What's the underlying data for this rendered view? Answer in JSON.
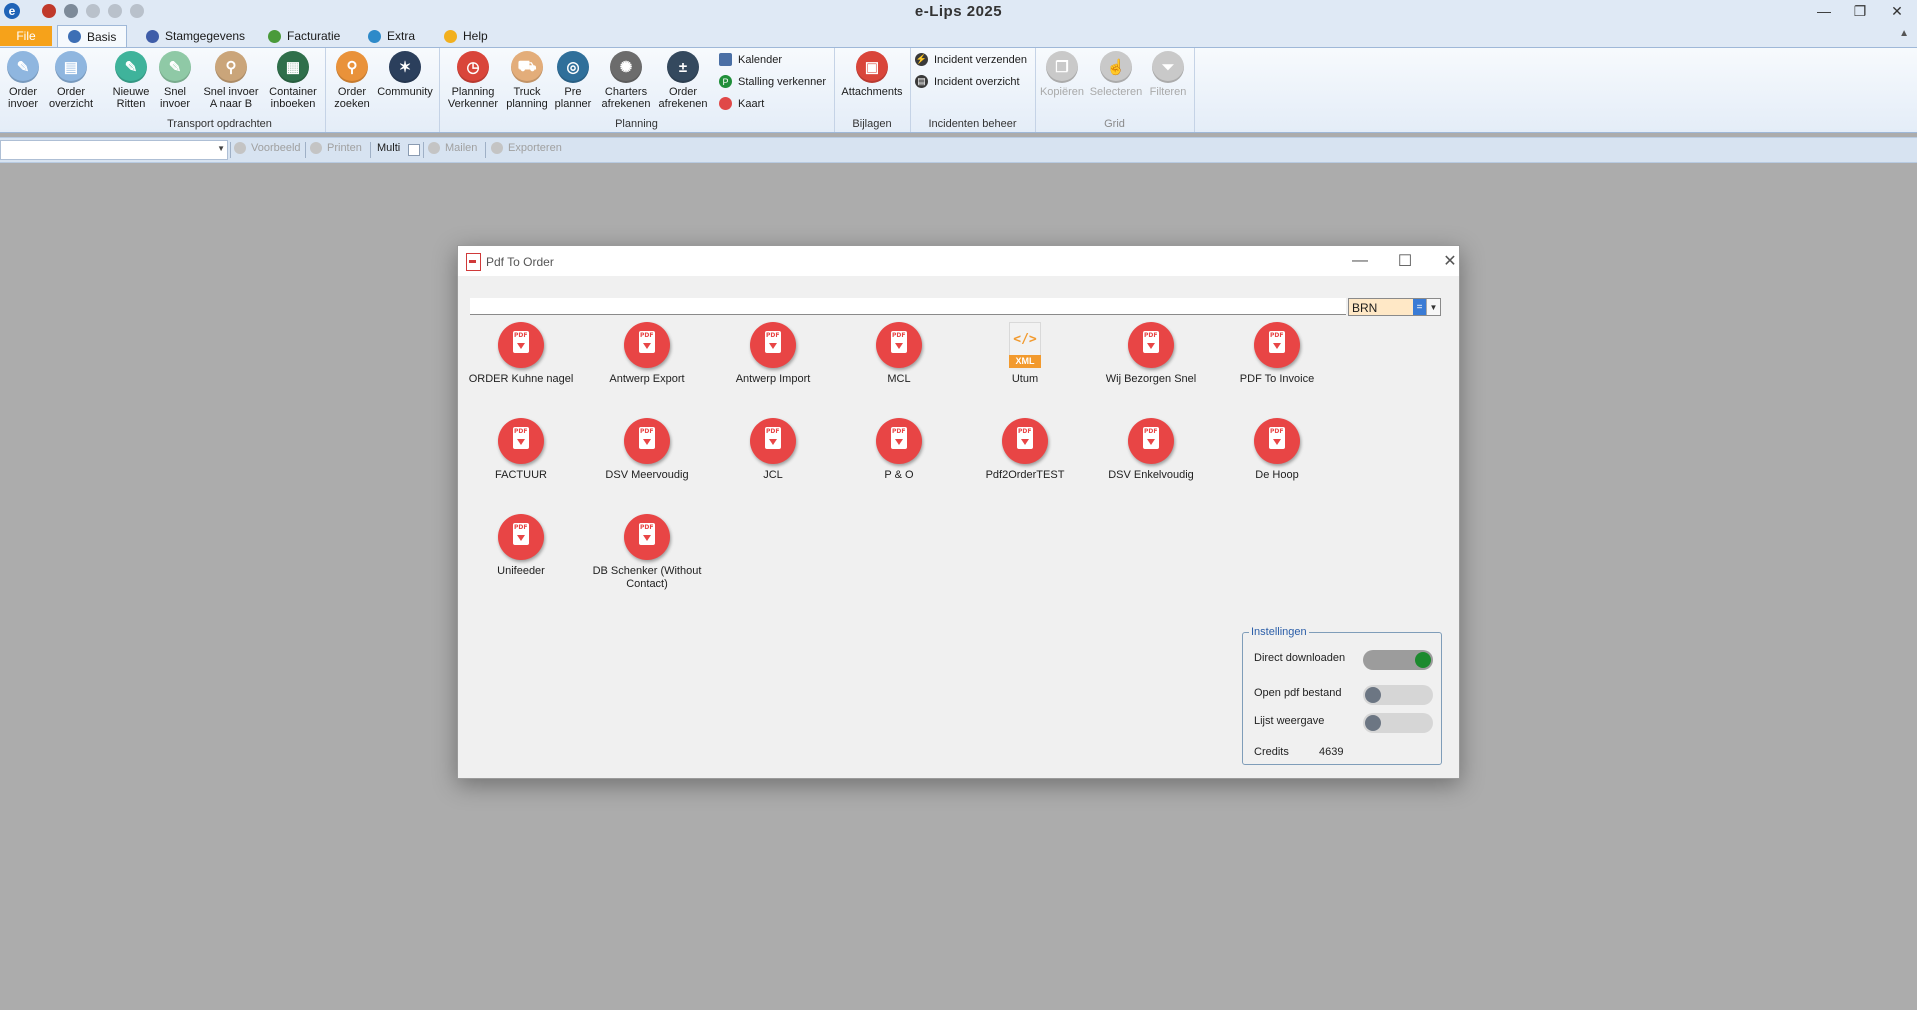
{
  "app": {
    "title": "e-Lips 2025"
  },
  "tabs": [
    {
      "label": "File"
    },
    {
      "label": "Basis"
    },
    {
      "label": "Stamgegevens"
    },
    {
      "label": "Facturatie"
    },
    {
      "label": "Extra"
    },
    {
      "label": "Help"
    }
  ],
  "ribbon": {
    "groups": [
      {
        "label": "Transport opdrachten"
      },
      {
        "label": "Planning"
      },
      {
        "label": "Bijlagen"
      },
      {
        "label": "Incidenten beheer"
      },
      {
        "label": "Grid"
      }
    ],
    "buttons": {
      "order_invoer": "Order\ninvoer",
      "order_overzicht": "Order\noverzicht",
      "nieuwe_ritten": "Nieuwe\nRitten",
      "snel_invoer": "Snel\ninvoer",
      "snel_invoer_ab": "Snel invoer\nA naar B",
      "container_inboeken": "Container\ninboeken",
      "order_zoeken": "Order\nzoeken",
      "community": "Community",
      "planning_verkenner": "Planning\nVerkenner",
      "truck_planning": "Truck\nplanning",
      "pre_planner": "Pre\nplanner",
      "charters_afrekenen": "Charters\nafrekenen",
      "order_afrekenen": "Order\nafrekenen",
      "kalender": "Kalender",
      "stalling_verkenner": "Stalling verkenner",
      "kaart": "Kaart",
      "attachments": "Attachments",
      "incident_verzenden": "Incident verzenden",
      "incident_overzicht": "Incident overzicht",
      "kopieren": "Kopiëren",
      "selecteren": "Selecteren",
      "filteren": "Filteren"
    }
  },
  "toolbar2": {
    "voorbeeld": "Voorbeeld",
    "printen": "Printen",
    "multi": "Multi",
    "mailen": "Mailen",
    "exporteren": "Exporteren"
  },
  "dialog": {
    "title": "Pdf To Order",
    "search_value": "",
    "combo_value": "BRN",
    "items": [
      {
        "label": "ORDER Kuhne nagel",
        "type": "pdf"
      },
      {
        "label": "Antwerp Export",
        "type": "pdf"
      },
      {
        "label": "Antwerp Import",
        "type": "pdf"
      },
      {
        "label": "MCL",
        "type": "pdf"
      },
      {
        "label": "Utum",
        "type": "xml"
      },
      {
        "label": "Wij Bezorgen Snel",
        "type": "pdf"
      },
      {
        "label": "PDF To Invoice",
        "type": "pdf"
      },
      {
        "label": "FACTUUR",
        "type": "pdf"
      },
      {
        "label": "DSV Meervoudig",
        "type": "pdf"
      },
      {
        "label": "JCL",
        "type": "pdf"
      },
      {
        "label": "P & O",
        "type": "pdf"
      },
      {
        "label": "Pdf2OrderTEST",
        "type": "pdf"
      },
      {
        "label": "DSV Enkelvoudig",
        "type": "pdf"
      },
      {
        "label": "De Hoop",
        "type": "pdf"
      },
      {
        "label": "Unifeeder",
        "type": "pdf"
      },
      {
        "label": "DB Schenker (Without\nContact)",
        "type": "pdf"
      }
    ],
    "xml_badge": "XML",
    "xml_code": "</>",
    "settings": {
      "legend": "Instellingen",
      "direct_downloaden": {
        "label": "Direct downloaden",
        "on": true
      },
      "open_pdf": {
        "label": "Open pdf bestand",
        "on": false
      },
      "lijst_weergave": {
        "label": "Lijst weergave",
        "on": false
      },
      "credits_label": "Credits",
      "credits_value": "4639"
    }
  },
  "colors": {
    "accent": "#f6a21a",
    "pdf_red": "#e84545",
    "toggle_on": "#1c8a2e",
    "xml_orange": "#f29a2e"
  }
}
